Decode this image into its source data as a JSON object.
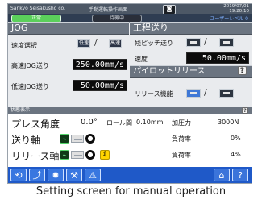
{
  "header": {
    "company": "Sankyo Seisakusho co.",
    "title": "手動運転操作画面",
    "date": "2019/07/01",
    "time": "19:20:10",
    "camera_icon": "camera-icon"
  },
  "modebar": {
    "normal": "正常",
    "standby": "待機中",
    "user_level": "ユーザーレベル 0"
  },
  "jog": {
    "title": "JOG",
    "speed_select_label": "速度選択",
    "low_btn": "低速",
    "high_btn": "高速",
    "high_jog_label": "高速JOG送り",
    "high_jog_value": "250.00mm/s",
    "low_jog_label": "低速JOG送り",
    "low_jog_value": "50.00mm/s"
  },
  "process": {
    "title": "工程送り",
    "remain_pitch_label": "残ピッチ送り",
    "speed_label": "速度",
    "speed_value": "50.00mm/s"
  },
  "pilot": {
    "title": "パイロットリリース",
    "function_label": "リリース機能"
  },
  "status": {
    "header": "状態表示",
    "press_angle_label": "プレス角度",
    "press_angle_value": "0.0°",
    "roller_label": "ロール間",
    "roller_value": "0.10mm",
    "pressure_label": "加圧力",
    "pressure_value": "3000N",
    "feed_axis_label": "送り軸",
    "feed_load_label": "負荷率",
    "feed_load_value": "0%",
    "release_axis_label": "リリース軸",
    "release_load_label": "負荷率",
    "release_load_value": "4%"
  },
  "help": "?",
  "caption": "Setting screen for manual operation"
}
